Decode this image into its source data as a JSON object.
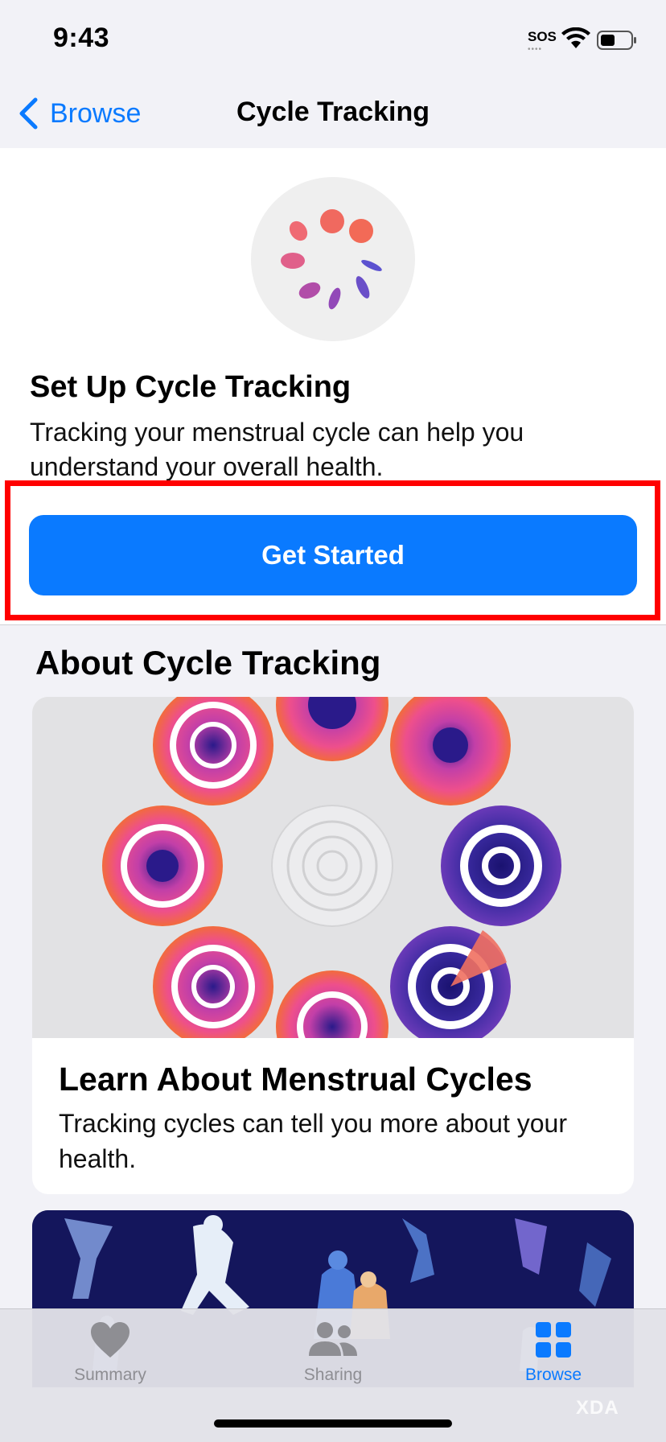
{
  "status_bar": {
    "time": "9:43",
    "sos": "SOS"
  },
  "nav": {
    "back_label": "Browse",
    "title": "Cycle Tracking"
  },
  "setup": {
    "icon": "cycle-tracking-icon",
    "title": "Set Up Cycle Tracking",
    "description": "Tracking your menstrual cycle can help you understand your overall health.",
    "button_label": "Get Started"
  },
  "about": {
    "heading": "About Cycle Tracking",
    "articles": [
      {
        "title": "Learn About Menstrual Cycles",
        "description": "Tracking cycles can tell you more about your health."
      }
    ]
  },
  "tab_bar": {
    "tabs": [
      {
        "label": "Summary",
        "icon": "heart-icon",
        "active": false
      },
      {
        "label": "Sharing",
        "icon": "people-icon",
        "active": false
      },
      {
        "label": "Browse",
        "icon": "grid-icon",
        "active": true
      }
    ]
  },
  "watermark": "XDA",
  "colors": {
    "accent": "#0a7aff",
    "highlight": "#ff0000"
  }
}
